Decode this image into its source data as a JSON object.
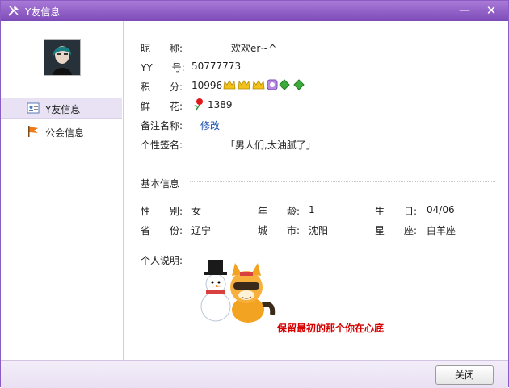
{
  "window": {
    "title": "Y友信息",
    "minimize_label": "—",
    "close_label": "✕"
  },
  "sidebar": {
    "items": [
      {
        "label": "Y友信息",
        "icon": "contact-card-icon",
        "active": true
      },
      {
        "label": "公会信息",
        "icon": "flag-icon",
        "active": false
      }
    ]
  },
  "profile": {
    "nickname_label": "昵　　称:",
    "nickname": "欢欢er~^",
    "yy_label": "YY　　号:",
    "yy": "50777773",
    "points_label": "积　　分:",
    "points": "10996",
    "flowers_label": "鲜　　花:",
    "flowers": "1389",
    "remark_label": "备注名称:",
    "remark_link": "修改",
    "signature_label": "个性签名:",
    "signature": "「男人们,太油腻了」"
  },
  "basic": {
    "title": "基本信息",
    "gender_label": "性　　别:",
    "gender": "女",
    "age_label": "年　　龄:",
    "age": "1",
    "birthday_label": "生　　日:",
    "birthday": "04/06",
    "province_label": "省　　份:",
    "province": "辽宁",
    "city_label": "城　　市:",
    "city": "沈阳",
    "zodiac_label": "星　　座:",
    "zodiac": "白羊座"
  },
  "about": {
    "label": "个人说明:",
    "caption": "保留最初的那个你在心底"
  },
  "footer": {
    "close_button": "关闭"
  },
  "colors": {
    "title_bar": "#8f5cc8",
    "link": "#1b4fae",
    "caption": "#d60000"
  }
}
